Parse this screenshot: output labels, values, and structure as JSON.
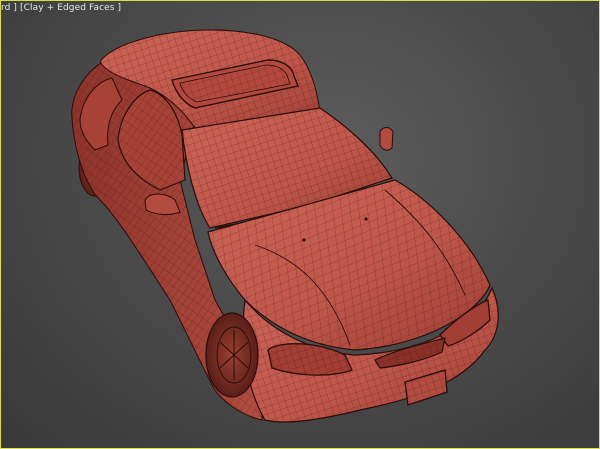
{
  "viewport": {
    "label_left": "rd ]",
    "label_shading": "[Clay + Edged Faces ]",
    "model": "car-wireframe-model",
    "colors": {
      "clay": "#c0574b",
      "clay_dark": "#8a3128",
      "wire": "#3a1410",
      "background": "#4b4b4b",
      "active_border": "#d7e04b"
    }
  }
}
